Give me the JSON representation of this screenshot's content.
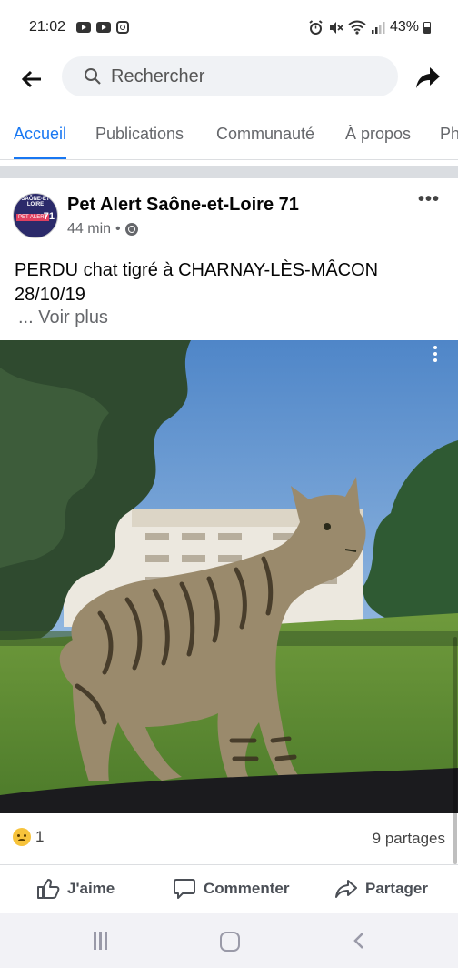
{
  "status_bar": {
    "time": "21:02",
    "battery": "43%",
    "icons": [
      "youtube-icon",
      "youtube-icon",
      "instagram-icon",
      "alarm-icon",
      "mute-icon",
      "wifi-icon",
      "signal-icon",
      "battery-icon"
    ]
  },
  "header": {
    "search_placeholder": "Rechercher",
    "back_icon": "arrow-left-icon",
    "share_icon": "share-arrow-icon"
  },
  "tabs": [
    {
      "label": "Accueil",
      "active": true
    },
    {
      "label": "Publications",
      "active": false
    },
    {
      "label": "Communauté",
      "active": false
    },
    {
      "label": "À propos",
      "active": false
    },
    {
      "label": "Ph",
      "active": false
    }
  ],
  "post": {
    "page_name": "Pet Alert Saône-et-Loire 71",
    "time": "44 min",
    "separator": "•",
    "text_line1": "PERDU chat tigré à CHARNAY-LÈS-MÂCON",
    "text_line2": "28/10/19",
    "see_more": "... Voir plus",
    "avatar": {
      "top": "SAÔNE-ET LOIRE",
      "badge": "PET ALERT",
      "number": "71"
    },
    "more_icon": "ellipsis-icon"
  },
  "stats": {
    "reaction_icon": "sad-emoji-icon",
    "reaction_count": "1",
    "shares": "9 partages"
  },
  "actions": {
    "like": "J'aime",
    "comment": "Commenter",
    "share": "Partager"
  },
  "colors": {
    "accent": "#1877f2",
    "secondary_text": "#65676b",
    "divider": "#dadde1"
  }
}
